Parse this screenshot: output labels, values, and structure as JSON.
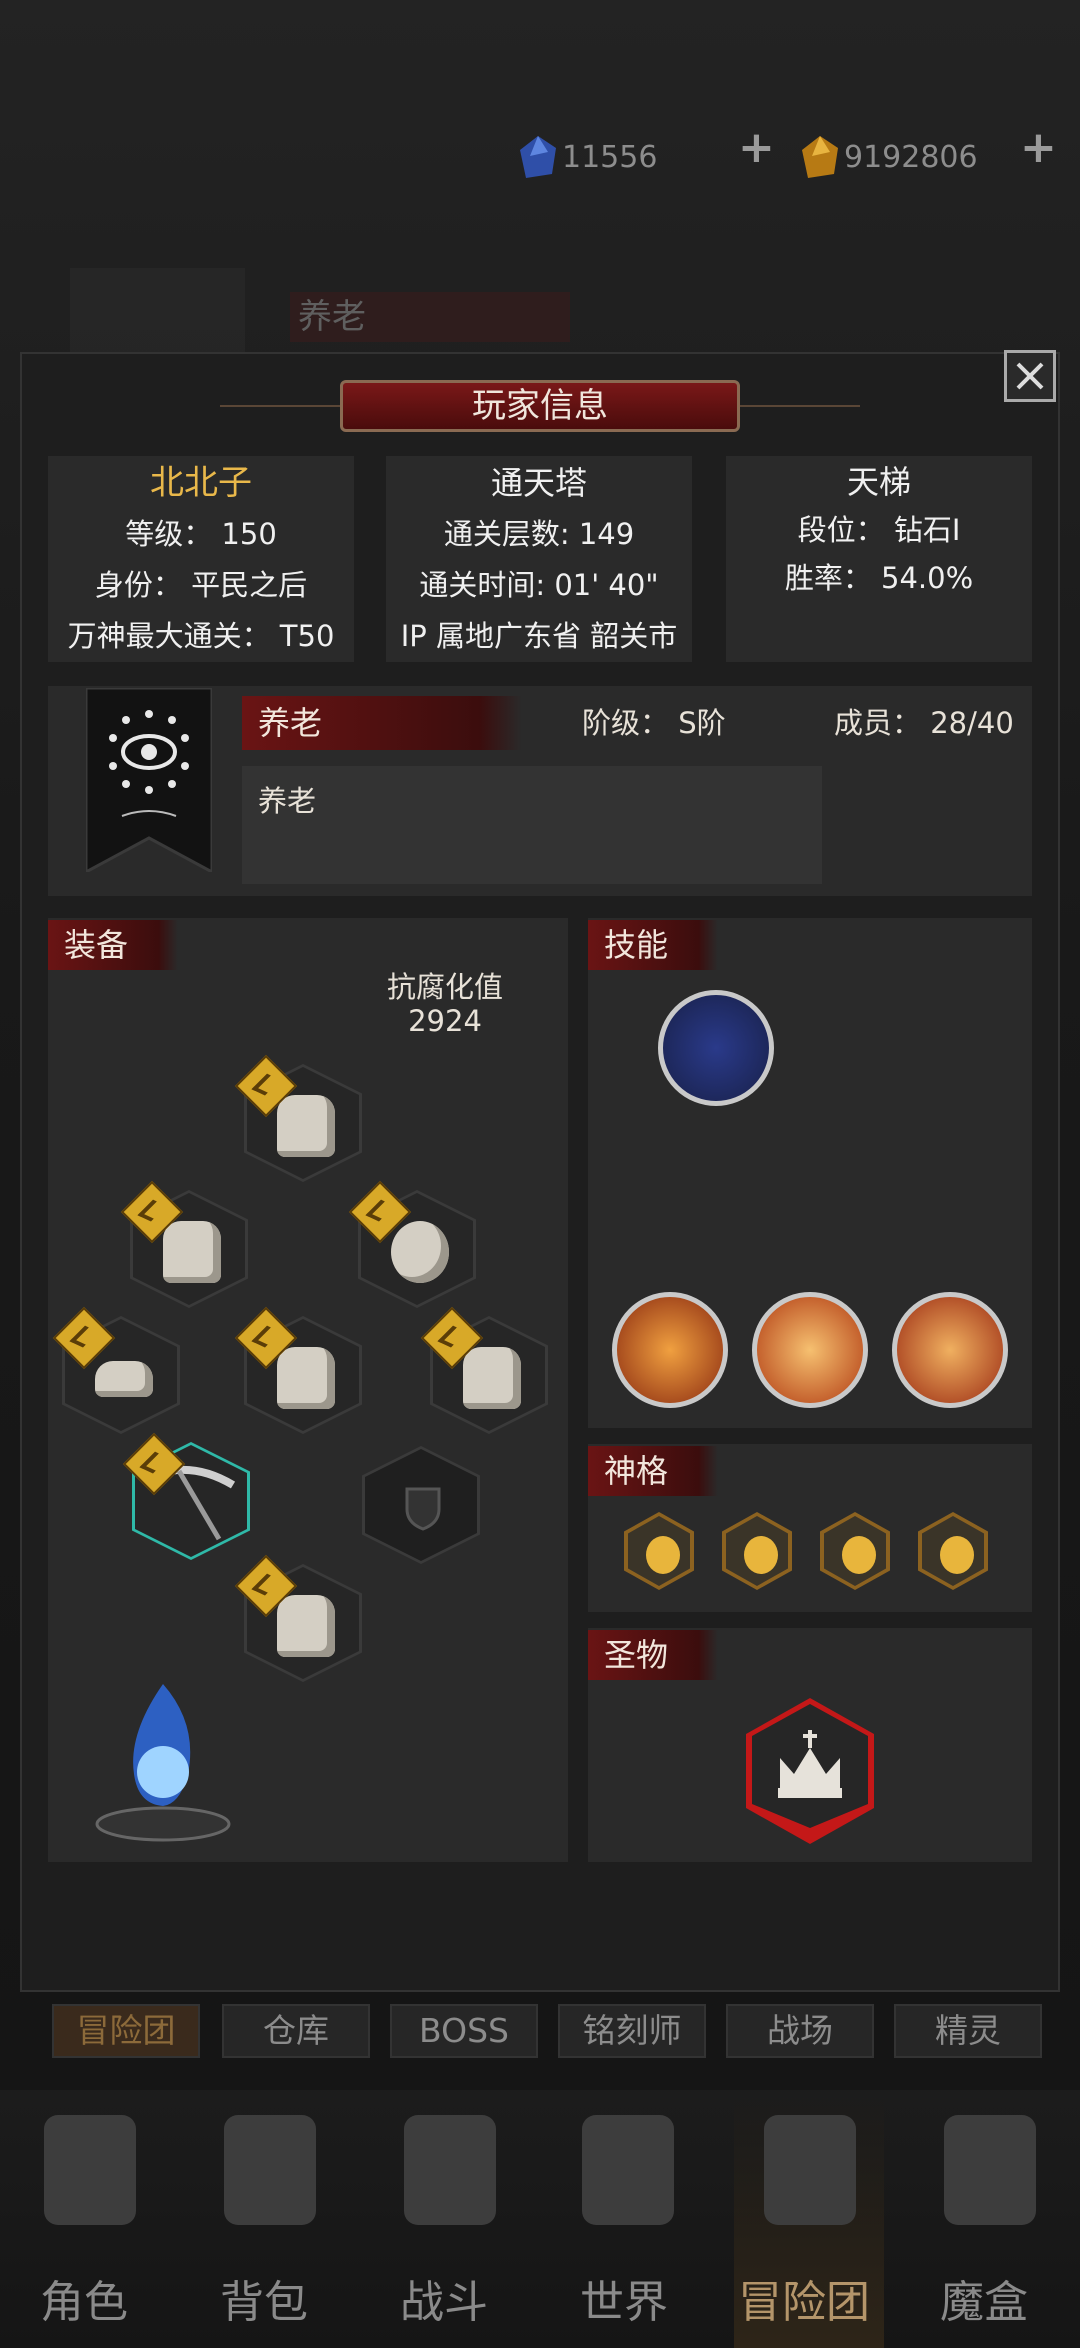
{
  "currencies": [
    {
      "icon": "blue-gem-icon",
      "value": "11556",
      "plus": "+"
    },
    {
      "icon": "gold-gem-icon",
      "value": "9192806",
      "plus": "+"
    }
  ],
  "background": {
    "guild_name": "养老"
  },
  "modal": {
    "title": "玩家信息",
    "close": "×"
  },
  "player": {
    "name": "北北子",
    "level": "等级：  150",
    "identity": "身份：  平民之后",
    "max_clear": "万神最大通关：  T50"
  },
  "tower": {
    "title": "通天塔",
    "floors": "通关层数: 149",
    "time": "通关时间: 01' 40\"",
    "ip": "IP 属地广东省 韶关市"
  },
  "ladder": {
    "title": "天梯",
    "rank": "段位：  钻石I",
    "winrate": "胜率：  54.0%"
  },
  "guild": {
    "name": "养老",
    "grade": "阶级：  S阶",
    "members": "成员：  28/40",
    "notice": "养老"
  },
  "equipment": {
    "title": "装备",
    "resist_label": "抗腐化值",
    "resist_value": "2924"
  },
  "skills": {
    "title": "技能"
  },
  "divinity": {
    "title": "神格"
  },
  "relic": {
    "title": "圣物"
  },
  "tabs": [
    "冒险团",
    "仓库",
    "BOSS",
    "铭刻师",
    "战场",
    "精灵"
  ],
  "nav": [
    {
      "label": "角色",
      "icon": "helmet-icon"
    },
    {
      "label": "背包",
      "icon": "backpack-icon"
    },
    {
      "label": "战斗",
      "icon": "swords-icon"
    },
    {
      "label": "世界",
      "icon": "map-icon"
    },
    {
      "label": "冒险团",
      "icon": "castle-icon"
    },
    {
      "label": "魔盒",
      "icon": "cube-icon"
    }
  ],
  "colors": {
    "accent_red": "#6a1414",
    "gold": "#e9b84a",
    "panel": "#2a2a2a"
  }
}
